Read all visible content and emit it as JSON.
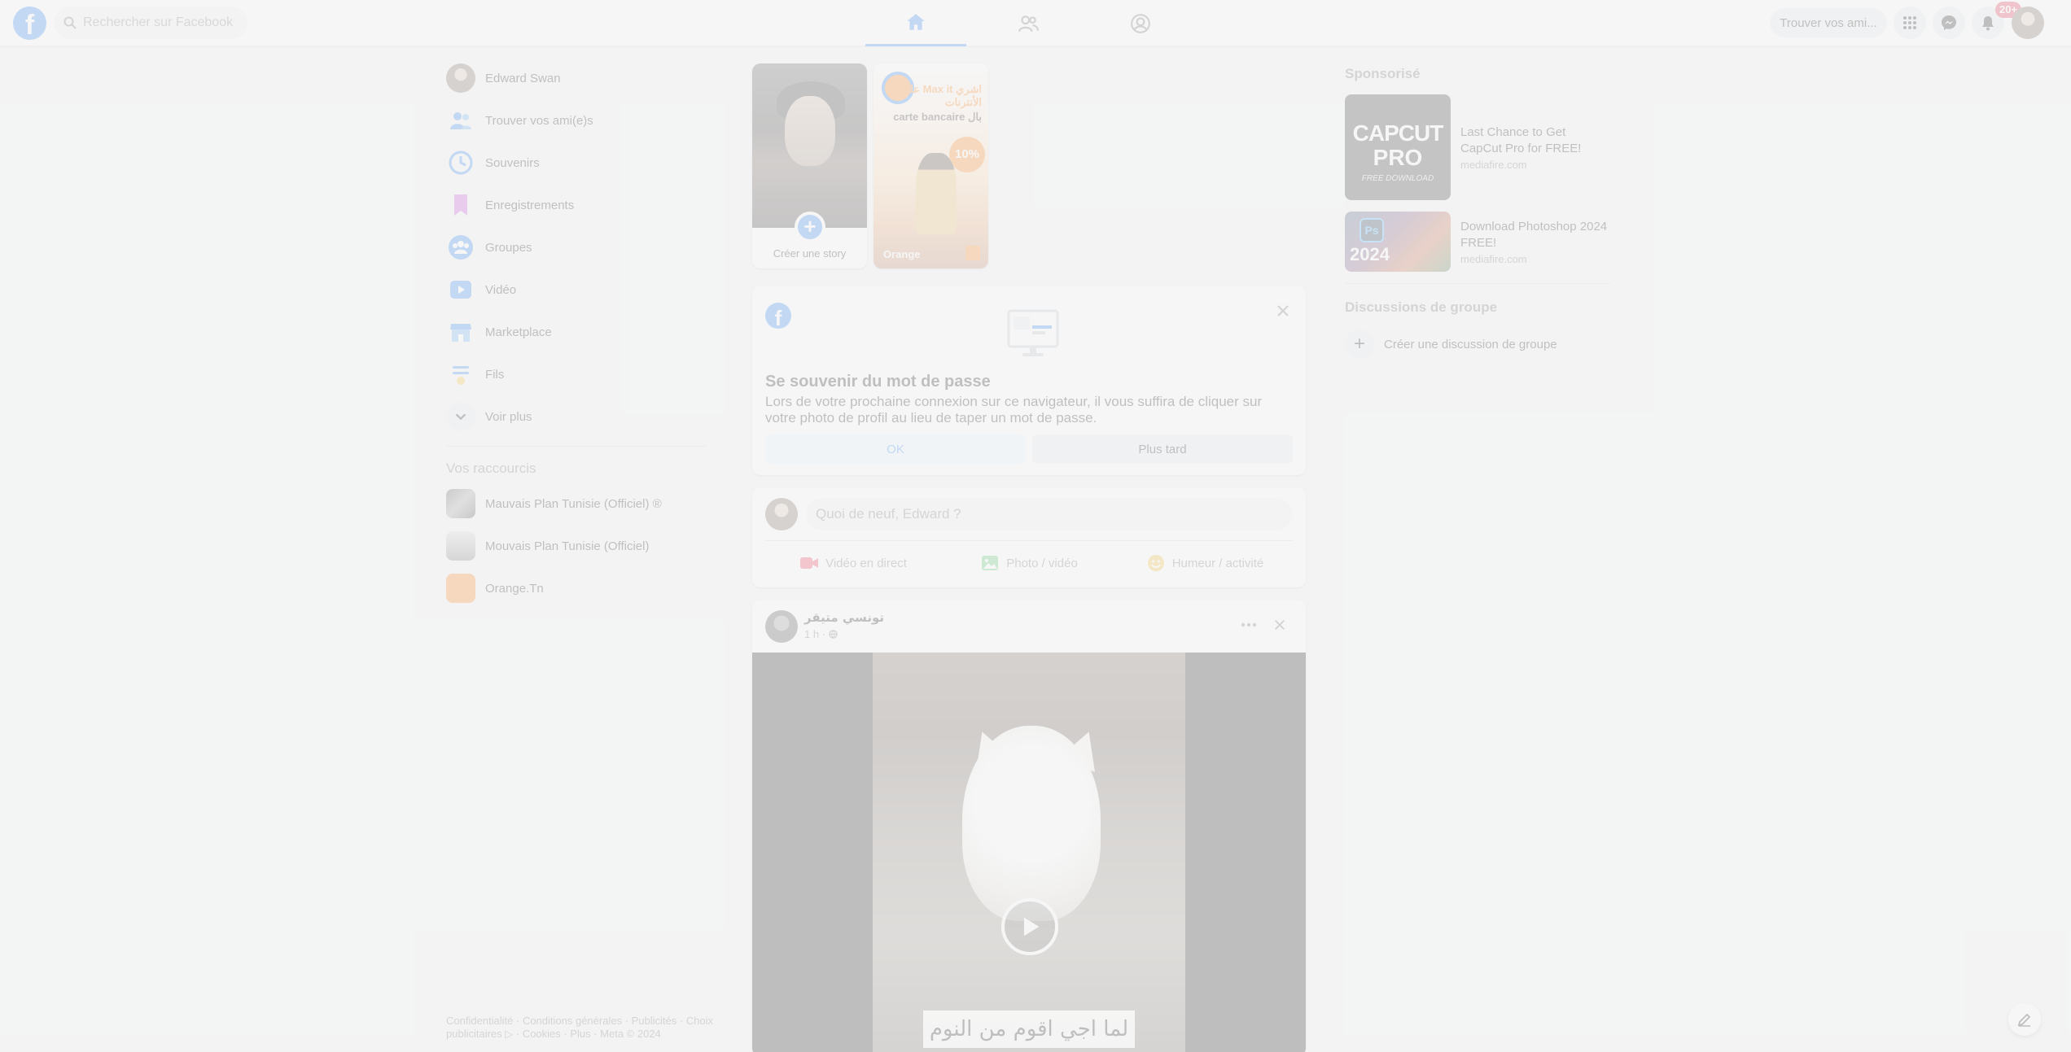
{
  "topbar": {
    "logo_letter": "f",
    "search_placeholder": "Rechercher sur Facebook",
    "tabs": [
      {
        "name": "home",
        "icon": "home-icon",
        "active": true
      },
      {
        "name": "friends",
        "icon": "friends-icon",
        "active": false
      },
      {
        "name": "profile",
        "icon": "profile-circle-icon",
        "active": false
      }
    ],
    "find_friends_label": "Trouver vos ami...",
    "menu_icon": "grid-menu-icon",
    "messenger_icon": "messenger-icon",
    "notifications_icon": "bell-icon",
    "notifications_badge": "20+"
  },
  "left_nav": {
    "items": [
      {
        "label": "Edward Swan",
        "icon": "avatar"
      },
      {
        "label": "Trouver vos ami(e)s",
        "icon": "friends-icon"
      },
      {
        "label": "Souvenirs",
        "icon": "clock-icon"
      },
      {
        "label": "Enregistrements",
        "icon": "bookmark-icon"
      },
      {
        "label": "Groupes",
        "icon": "groups-icon"
      },
      {
        "label": "Vidéo",
        "icon": "video-icon"
      },
      {
        "label": "Marketplace",
        "icon": "marketplace-icon"
      },
      {
        "label": "Fils",
        "icon": "feeds-icon"
      },
      {
        "label": "Voir plus",
        "icon": "chevron-down-icon"
      }
    ],
    "shortcuts_title": "Vos raccourcis",
    "shortcuts": [
      {
        "label": "Mauvais Plan Tunisie (Officiel) ®"
      },
      {
        "label": "Mouvais Plan Tunisie (Officiel)"
      },
      {
        "label": "Orange.Tn"
      }
    ],
    "footer_line1": "Confidentialité · Conditions générales · Publicités · Choix",
    "footer_line2": "publicitaires ▷ · Cookies · Plus · Meta © 2024"
  },
  "stories": {
    "create_label": "Créer une story",
    "create_plus": "+",
    "orange_story": {
      "headline": "على Max it اشري الأنترنات",
      "subline": "carte bancaire بال",
      "discount": "10%",
      "brand": "Orange"
    }
  },
  "password_prompt": {
    "fb_letter": "f",
    "title": "Se souvenir du mot de passe",
    "text": "Lors de votre prochaine connexion sur ce navigateur, il vous suffira de cliquer sur votre photo de profil au lieu de taper un mot de passe.",
    "ok_label": "OK",
    "later_label": "Plus tard"
  },
  "composer": {
    "placeholder": "Quoi de neuf, Edward ?",
    "actions": [
      {
        "label": "Vidéo en direct",
        "icon": "live-video-icon",
        "color": "#f02849"
      },
      {
        "label": "Photo / vidéo",
        "icon": "photo-icon",
        "color": "#45bd62"
      },
      {
        "label": "Humeur / activité",
        "icon": "feeling-icon",
        "color": "#f7b928"
      }
    ]
  },
  "post": {
    "author": "تونسي متيقر",
    "time": "1 h ·",
    "caption_overlay": "لما اجي اقوم من النوم"
  },
  "right_rail": {
    "sponsored_title": "Sponsorisé",
    "ads": [
      {
        "title": "Last Chance to Get CapCut Pro for FREE!",
        "domain": "mediafire.com",
        "thumb_line1": "CAPCUT",
        "thumb_line2": "PRO",
        "thumb_line3": "FREE DOWNLOAD"
      },
      {
        "title": "Download Photoshop 2024 FREE!",
        "domain": "mediafire.com",
        "thumb_logo": "Ps",
        "thumb_year": "2024"
      }
    ],
    "group_chats_title": "Discussions de groupe",
    "create_group_chat_label": "Créer une discussion de groupe"
  },
  "colors": {
    "brand_blue": "#1877f2",
    "background": "#f0f2f5",
    "overlay": "rgba(244,244,244,0.78)"
  }
}
